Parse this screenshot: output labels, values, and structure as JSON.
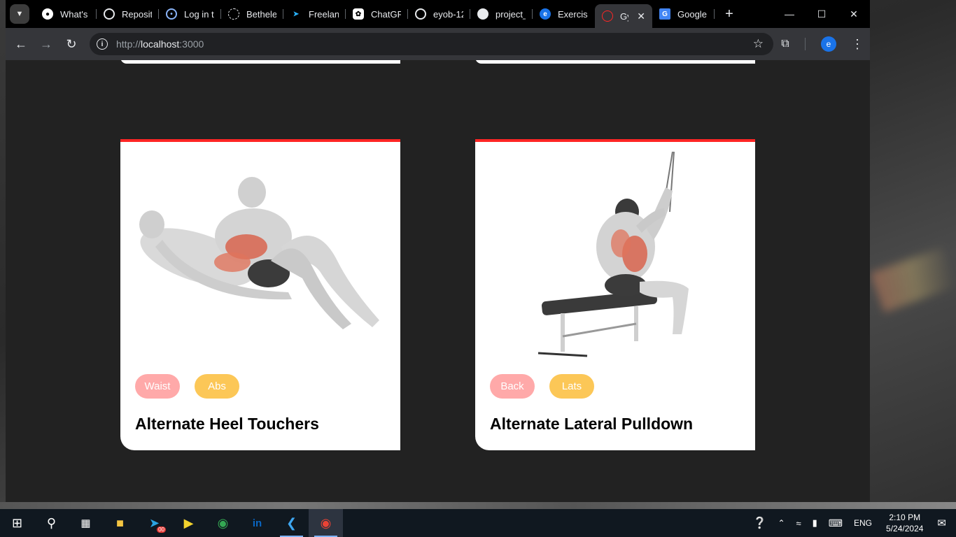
{
  "browser": {
    "tabs": [
      {
        "label": "What's I",
        "icon": "chrome-icon",
        "active": false
      },
      {
        "label": "Reposit",
        "icon": "github-icon",
        "active": false
      },
      {
        "label": "Log in t",
        "icon": "login-icon",
        "active": false
      },
      {
        "label": "Bethelel",
        "icon": "dashed-circle-icon",
        "active": false
      },
      {
        "label": "Freelanc",
        "icon": "freelancer-icon",
        "active": false
      },
      {
        "label": "ChatGP",
        "icon": "chatgpt-icon",
        "active": false
      },
      {
        "label": "eyob-12",
        "icon": "github-icon",
        "active": false
      },
      {
        "label": "project_",
        "icon": "github-icon",
        "active": false
      },
      {
        "label": "Exercise",
        "icon": "exercise-icon",
        "active": false
      },
      {
        "label": "Gyr",
        "icon": "gym-icon",
        "active": true
      },
      {
        "label": "Google",
        "icon": "google-translate-icon",
        "active": false
      }
    ],
    "url_prefix": "http://",
    "url_host": "localhost",
    "url_port": ":3000",
    "profile_initial": "e"
  },
  "cards": [
    {
      "tags": [
        "Waist",
        "Abs"
      ],
      "title": "Alternate Heel Touchers"
    },
    {
      "tags": [
        "Back",
        "Lats"
      ],
      "title": "Alternate Lateral Pulldown"
    }
  ],
  "taskbar": {
    "telegram_badge": "00",
    "language": "ENG",
    "time": "2:10 PM",
    "date": "5/24/2024"
  },
  "colors": {
    "accent": "#ff2625",
    "tag_primary": "#ffa9a9",
    "tag_secondary": "#fcc757",
    "page_bg": "#222222"
  }
}
